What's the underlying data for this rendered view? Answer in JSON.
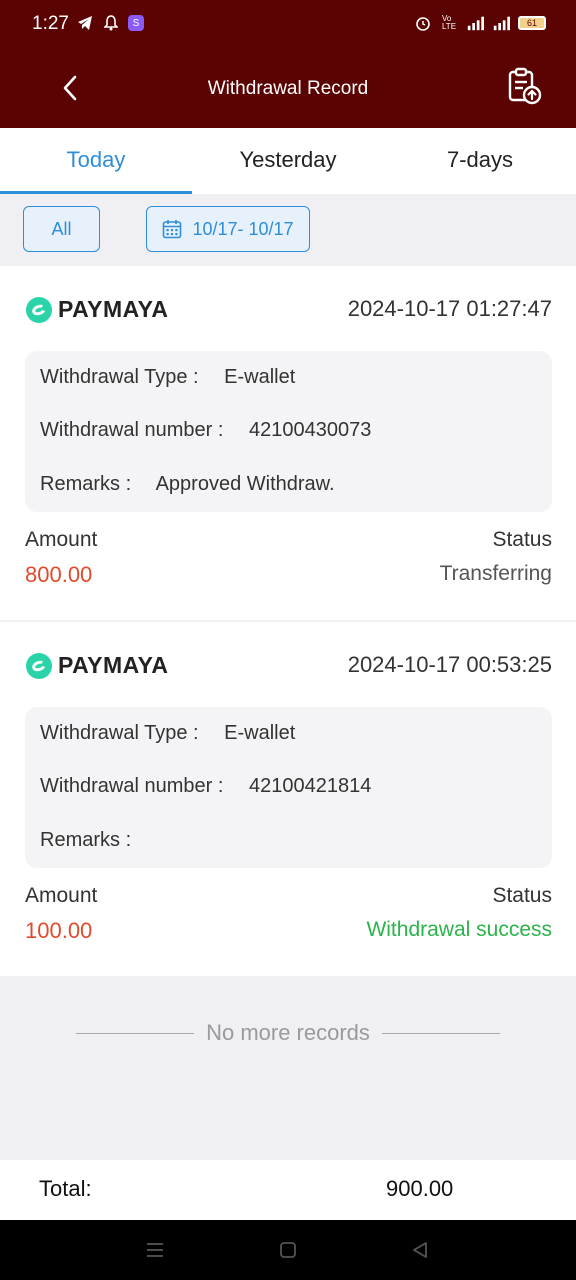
{
  "status_bar": {
    "time": "1:27",
    "left_icons": [
      "telegram-icon",
      "bell-icon",
      "app-s-icon"
    ],
    "right_icons": [
      "alarm-icon",
      "volte-icon",
      "4g-signal-icon",
      "signal-icon"
    ],
    "battery": "61"
  },
  "header": {
    "title": "Withdrawal Record"
  },
  "tabs": [
    {
      "label": "Today",
      "active": true
    },
    {
      "label": "Yesterday",
      "active": false
    },
    {
      "label": "7-days",
      "active": false
    }
  ],
  "filters": {
    "all_label": "All",
    "date_range": "10/17- 10/17"
  },
  "colors": {
    "header_bg": "#5b0303",
    "accent": "#2f8ed9",
    "amount": "#e14b2c",
    "success": "#2bb44a"
  },
  "records": [
    {
      "provider": "PAYMAYA",
      "datetime": "2024-10-17 01:27:47",
      "type_label": "Withdrawal Type :",
      "type_value": "E-wallet",
      "number_label": "Withdrawal number :",
      "number_value": "42100430073",
      "remarks_label": "Remarks :",
      "remarks_value": "Approved Withdraw.",
      "amount_label": "Amount",
      "amount_value": "800.00",
      "status_label": "Status",
      "status_value": "Transferring"
    },
    {
      "provider": "PAYMAYA",
      "datetime": "2024-10-17 00:53:25",
      "type_label": "Withdrawal Type :",
      "type_value": "E-wallet",
      "number_label": "Withdrawal number :",
      "number_value": "42100421814",
      "remarks_label": "Remarks :",
      "remarks_value": "",
      "amount_label": "Amount",
      "amount_value": "100.00",
      "status_label": "Status",
      "status_value": "Withdrawal success"
    }
  ],
  "no_more_text": "No more records",
  "total": {
    "label": "Total:",
    "value": "900.00"
  }
}
